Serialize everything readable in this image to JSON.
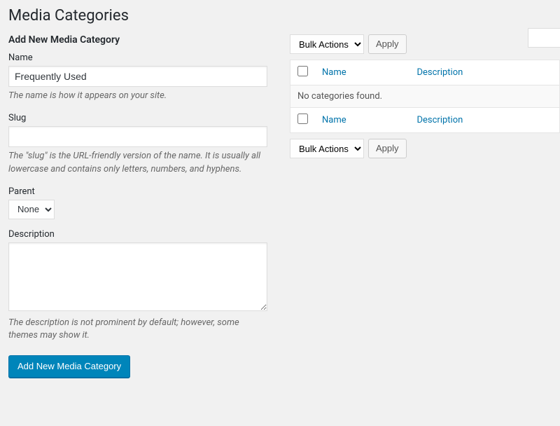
{
  "page": {
    "title": "Media Categories"
  },
  "form": {
    "heading": "Add New Media Category",
    "name": {
      "label": "Name",
      "value": "Frequently Used",
      "hint": "The name is how it appears on your site."
    },
    "slug": {
      "label": "Slug",
      "value": "",
      "hint": "The \"slug\" is the URL-friendly version of the name. It is usually all lowercase and contains only letters, numbers, and hyphens."
    },
    "parent": {
      "label": "Parent",
      "selected": "None"
    },
    "description": {
      "label": "Description",
      "value": "",
      "hint": "The description is not prominent by default; however, some themes may show it."
    },
    "submit_label": "Add New Media Category"
  },
  "table": {
    "bulk": {
      "label": "Bulk Actions",
      "apply": "Apply"
    },
    "columns": {
      "name": "Name",
      "description": "Description"
    },
    "empty": "No categories found."
  }
}
